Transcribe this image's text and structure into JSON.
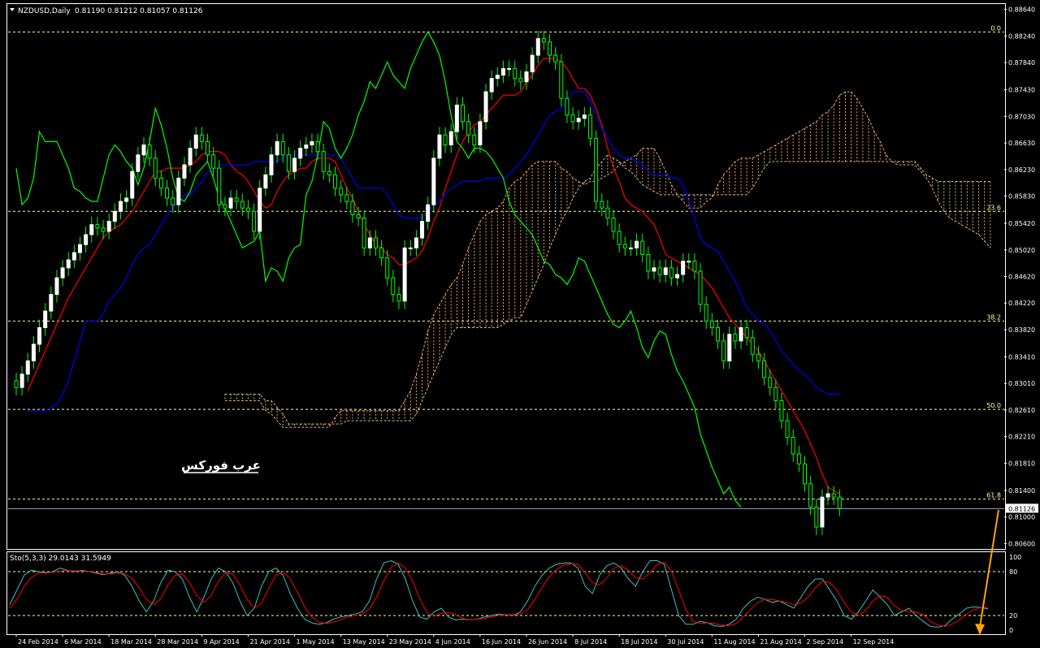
{
  "window": {
    "symbol": "NZDUSD,Daily",
    "ohlc": "0.81190 0.81212 0.81057 0.81126",
    "watermark": "عرب فوركس",
    "indicator_label": "Sto(5,3,3) 29.0143 31.5949"
  },
  "colors": {
    "background": "#000000",
    "candle": "#ffffff",
    "candle_wick": "#00ff00",
    "tenkan": "#ff0000",
    "kijun": "#0000ff",
    "chikou": "#00ff00",
    "cloud_up": "#f4a460",
    "cloud_down": "#d2b48c",
    "fib": "#ffff99",
    "stoch_main": "#40c0c0",
    "stoch_signal": "#ff0000",
    "arrow": "#ffa500",
    "axis": "#ffffff",
    "price_line": "#8fa9c7"
  },
  "chart_data": [
    {
      "type": "candlestick",
      "symbol": "NZDUSD",
      "timeframe": "Daily",
      "price_axis_ticks": [
        "0.88640",
        "0.88240",
        "0.87840",
        "0.87430",
        "0.87030",
        "0.86630",
        "0.86230",
        "0.85830",
        "0.85420",
        "0.85020",
        "0.84620",
        "0.84220",
        "0.83820",
        "0.83410",
        "0.83010",
        "0.82610",
        "0.82210",
        "0.81810",
        "0.81400",
        "0.81000",
        "0.80600"
      ],
      "ylim": [
        0.8052,
        0.8872
      ],
      "date_axis_ticks": [
        "24 Feb 2014",
        "6 Mar 2014",
        "18 Mar 2014",
        "28 Mar 2014",
        "9 Apr 2014",
        "21 Apr 2014",
        "1 May 2014",
        "13 May 2014",
        "23 May 2014",
        "4 Jun 2014",
        "16 Jun 2014",
        "26 Jun 2014",
        "8 Jul 2014",
        "18 Jul 2014",
        "30 Jul 2014",
        "11 Aug 2014",
        "21 Aug 2014",
        "2 Sep 2014",
        "12 Sep 2014"
      ],
      "current_price": "0.81126",
      "fibonacci": [
        {
          "label": "0.0",
          "value": 0.883
        },
        {
          "label": "23.6",
          "value": 0.856
        },
        {
          "label": "38.2",
          "value": 0.8395
        },
        {
          "label": "50.0",
          "value": 0.8262
        },
        {
          "label": "61.8",
          "value": 0.8127
        }
      ],
      "closes": [
        0.8295,
        0.8315,
        0.8335,
        0.836,
        0.8385,
        0.841,
        0.8435,
        0.846,
        0.8475,
        0.8487,
        0.8498,
        0.851,
        0.8525,
        0.854,
        0.8535,
        0.853,
        0.8545,
        0.856,
        0.8575,
        0.858,
        0.862,
        0.8645,
        0.866,
        0.864,
        0.861,
        0.8595,
        0.858,
        0.857,
        0.861,
        0.863,
        0.8655,
        0.8675,
        0.8665,
        0.8645,
        0.8625,
        0.857,
        0.8565,
        0.858,
        0.8575,
        0.8565,
        0.856,
        0.853,
        0.8595,
        0.8615,
        0.8645,
        0.8665,
        0.8645,
        0.862,
        0.864,
        0.8655,
        0.866,
        0.8665,
        0.865,
        0.862,
        0.8615,
        0.8595,
        0.8585,
        0.8575,
        0.8555,
        0.855,
        0.8505,
        0.852,
        0.8505,
        0.849,
        0.846,
        0.8435,
        0.8425,
        0.8505,
        0.8505,
        0.852,
        0.8545,
        0.857,
        0.864,
        0.8675,
        0.866,
        0.868,
        0.872,
        0.8695,
        0.8675,
        0.866,
        0.8695,
        0.874,
        0.876,
        0.8765,
        0.8775,
        0.8775,
        0.876,
        0.8755,
        0.877,
        0.8795,
        0.882,
        0.8815,
        0.8795,
        0.8785,
        0.873,
        0.8705,
        0.8695,
        0.87,
        0.8705,
        0.867,
        0.8575,
        0.8565,
        0.855,
        0.853,
        0.851,
        0.8505,
        0.8505,
        0.8515,
        0.8495,
        0.847,
        0.8475,
        0.8465,
        0.8475,
        0.846,
        0.8465,
        0.8485,
        0.8485,
        0.847,
        0.842,
        0.8395,
        0.8385,
        0.8365,
        0.8335,
        0.8375,
        0.8365,
        0.8385,
        0.837,
        0.8345,
        0.8335,
        0.831,
        0.8295,
        0.8275,
        0.8245,
        0.822,
        0.8195,
        0.818,
        0.815,
        0.8115,
        0.8085,
        0.813,
        0.8135,
        0.813,
        0.8113
      ],
      "tenkan_sen": [
        0.829,
        0.831,
        0.833,
        0.835,
        0.837,
        0.839,
        0.841,
        0.843,
        0.8445,
        0.846,
        0.8475,
        0.849,
        0.8505,
        0.852,
        0.853,
        0.8535,
        0.854,
        0.855,
        0.856,
        0.8575,
        0.859,
        0.8605,
        0.862,
        0.862,
        0.8625,
        0.8625,
        0.8625,
        0.8625,
        0.863,
        0.8635,
        0.8645,
        0.865,
        0.865,
        0.865,
        0.8645,
        0.863,
        0.862,
        0.8615,
        0.8605,
        0.859,
        0.8575,
        0.8565,
        0.857,
        0.859,
        0.8605,
        0.8615,
        0.862,
        0.8625,
        0.8625,
        0.8635,
        0.864,
        0.864,
        0.864,
        0.8635,
        0.8615,
        0.8595,
        0.858,
        0.856,
        0.854,
        0.8525,
        0.851,
        0.8505,
        0.8495,
        0.849,
        0.848,
        0.848,
        0.8485,
        0.849,
        0.85,
        0.852,
        0.8545,
        0.8565,
        0.8595,
        0.862,
        0.8645,
        0.8665,
        0.868,
        0.869,
        0.8695,
        0.8705,
        0.8715,
        0.8725,
        0.8735,
        0.8735,
        0.8735,
        0.874,
        0.8755,
        0.8765,
        0.878,
        0.879,
        0.879,
        0.879,
        0.8785,
        0.8775,
        0.876,
        0.8745,
        0.8745,
        0.8735,
        0.8715,
        0.869,
        0.8655,
        0.8625,
        0.8605,
        0.858,
        0.857,
        0.8565,
        0.856,
        0.855,
        0.854,
        0.852,
        0.8495,
        0.849,
        0.8485,
        0.848,
        0.8475,
        0.847,
        0.8465,
        0.8455,
        0.8445,
        0.843,
        0.8415,
        0.84,
        0.839,
        0.838,
        0.837,
        0.836,
        0.835,
        0.8335,
        0.832,
        0.8305,
        0.829,
        0.8275,
        0.826,
        0.8245,
        0.823,
        0.821,
        0.819,
        0.8165,
        0.8145,
        0.814,
        0.8135
      ],
      "kijun_sen": [
        0.826,
        0.826,
        0.826,
        0.826,
        0.8265,
        0.827,
        0.8285,
        0.8305,
        0.8335,
        0.8365,
        0.8395,
        0.8395,
        0.8395,
        0.8405,
        0.8425,
        0.8435,
        0.8445,
        0.846,
        0.848,
        0.8495,
        0.8505,
        0.851,
        0.8525,
        0.854,
        0.8555,
        0.8565,
        0.8575,
        0.8585,
        0.8585,
        0.8595,
        0.8605,
        0.862,
        0.862,
        0.863,
        0.863,
        0.863,
        0.863,
        0.863,
        0.863,
        0.8635,
        0.8635,
        0.8635,
        0.8635,
        0.8635,
        0.864,
        0.8645,
        0.8645,
        0.8645,
        0.8645,
        0.8645,
        0.8645,
        0.8645,
        0.8645,
        0.8645,
        0.864,
        0.8625,
        0.861,
        0.8595,
        0.8595,
        0.8595,
        0.8595,
        0.8595,
        0.8585,
        0.857,
        0.8555,
        0.855,
        0.855,
        0.855,
        0.855,
        0.856,
        0.857,
        0.8575,
        0.8585,
        0.8595,
        0.86,
        0.8605,
        0.8605,
        0.8605,
        0.8605,
        0.861,
        0.861,
        0.861,
        0.861,
        0.8615,
        0.8625,
        0.8635,
        0.8645,
        0.866,
        0.8675,
        0.869,
        0.8705,
        0.871,
        0.8715,
        0.873,
        0.874,
        0.874,
        0.874,
        0.8725,
        0.8705,
        0.8685,
        0.867,
        0.8655,
        0.8645,
        0.864,
        0.864,
        0.8635,
        0.863,
        0.862,
        0.8615,
        0.8615,
        0.8615,
        0.861,
        0.861,
        0.86,
        0.8575,
        0.855,
        0.852,
        0.851,
        0.8505,
        0.85,
        0.8485,
        0.847,
        0.8455,
        0.8435,
        0.8415,
        0.8405,
        0.8395,
        0.839,
        0.838,
        0.8365,
        0.835,
        0.834,
        0.833,
        0.832,
        0.8315,
        0.8305,
        0.8295,
        0.829,
        0.8285,
        0.8285,
        0.8285
      ],
      "chikou_span": [
        0.8625,
        0.857,
        0.858,
        0.861,
        0.868,
        0.8665,
        0.8665,
        0.8665,
        0.8645,
        0.8625,
        0.8595,
        0.859,
        0.858,
        0.8575,
        0.8575,
        0.861,
        0.8645,
        0.866,
        0.865,
        0.8635,
        0.8625,
        0.86,
        0.8625,
        0.8665,
        0.8715,
        0.869,
        0.8655,
        0.861,
        0.858,
        0.8575,
        0.859,
        0.8615,
        0.8625,
        0.8635,
        0.861,
        0.858,
        0.8565,
        0.8545,
        0.8525,
        0.8505,
        0.851,
        0.8515,
        0.853,
        0.8455,
        0.8475,
        0.847,
        0.8455,
        0.849,
        0.8505,
        0.851,
        0.8585,
        0.8605,
        0.8645,
        0.8695,
        0.8685,
        0.8655,
        0.864,
        0.8655,
        0.8675,
        0.8705,
        0.8725,
        0.8755,
        0.8745,
        0.8765,
        0.8785,
        0.8765,
        0.8755,
        0.8745,
        0.8775,
        0.8795,
        0.8815,
        0.883,
        0.8815,
        0.8795,
        0.8755,
        0.8705,
        0.8665,
        0.8655,
        0.864,
        0.8655,
        0.8655,
        0.865,
        0.864,
        0.8625,
        0.861,
        0.8575,
        0.8555,
        0.8545,
        0.8535,
        0.8525,
        0.8505,
        0.8485,
        0.848,
        0.8465,
        0.846,
        0.845,
        0.8465,
        0.849,
        0.8485,
        0.8465,
        0.8445,
        0.8425,
        0.8405,
        0.839,
        0.8385,
        0.8395,
        0.841,
        0.8385,
        0.8355,
        0.834,
        0.8365,
        0.838,
        0.8375,
        0.8345,
        0.832,
        0.8305,
        0.8285,
        0.8265,
        0.8225,
        0.82,
        0.8175,
        0.8155,
        0.8135,
        0.8145,
        0.8125,
        0.8115
      ],
      "senkou_a": [
        0.8275,
        0.8275,
        0.8275,
        0.8275,
        0.8275,
        0.8275,
        0.8275,
        0.826,
        0.8255,
        0.8245,
        0.8235,
        0.8235,
        0.8235,
        0.8235,
        0.8235,
        0.8235,
        0.8235,
        0.8235,
        0.8235,
        0.825,
        0.826,
        0.826,
        0.826,
        0.826,
        0.826,
        0.826,
        0.826,
        0.826,
        0.826,
        0.826,
        0.826,
        0.8275,
        0.829,
        0.8315,
        0.8345,
        0.838,
        0.8405,
        0.842,
        0.8435,
        0.845,
        0.846,
        0.848,
        0.8505,
        0.8525,
        0.8545,
        0.8555,
        0.856,
        0.8565,
        0.8575,
        0.8595,
        0.8605,
        0.861,
        0.862,
        0.863,
        0.8635,
        0.8635,
        0.8635,
        0.8635,
        0.8625,
        0.862,
        0.861,
        0.8605,
        0.86,
        0.8605,
        0.8605,
        0.861,
        0.8615,
        0.862,
        0.863,
        0.8635,
        0.864,
        0.8645,
        0.8655,
        0.8655,
        0.8655,
        0.864,
        0.862,
        0.86,
        0.8585,
        0.8575,
        0.8565,
        0.8565,
        0.8565,
        0.8575,
        0.858,
        0.86,
        0.8615,
        0.8625,
        0.8635,
        0.864,
        0.864,
        0.864,
        0.8645,
        0.865,
        0.8655,
        0.866,
        0.8665,
        0.867,
        0.8675,
        0.868,
        0.8685,
        0.869,
        0.8695,
        0.8705,
        0.871,
        0.872,
        0.8735,
        0.874,
        0.874,
        0.873,
        0.8715,
        0.87,
        0.868,
        0.8665,
        0.8645,
        0.8635,
        0.863,
        0.863,
        0.863,
        0.863,
        0.862,
        0.861,
        0.8595,
        0.8575,
        0.856,
        0.855,
        0.8545,
        0.854,
        0.8535,
        0.853,
        0.8525,
        0.8515,
        0.8505
      ],
      "senkou_b": [
        0.8285,
        0.8285,
        0.8285,
        0.8285,
        0.8285,
        0.8285,
        0.8285,
        0.8275,
        0.8275,
        0.8265,
        0.8255,
        0.824,
        0.824,
        0.824,
        0.824,
        0.824,
        0.824,
        0.824,
        0.824,
        0.824,
        0.824,
        0.8245,
        0.8245,
        0.8245,
        0.8245,
        0.8245,
        0.8245,
        0.8245,
        0.8245,
        0.8245,
        0.8245,
        0.8245,
        0.8245,
        0.8255,
        0.8275,
        0.8295,
        0.8315,
        0.8335,
        0.8355,
        0.8375,
        0.8385,
        0.8385,
        0.8385,
        0.8385,
        0.8385,
        0.8385,
        0.8385,
        0.8385,
        0.839,
        0.8395,
        0.84,
        0.84,
        0.842,
        0.844,
        0.846,
        0.848,
        0.8505,
        0.8525,
        0.8545,
        0.856,
        0.858,
        0.8595,
        0.8605,
        0.861,
        0.8625,
        0.8635,
        0.8645,
        0.864,
        0.8635,
        0.8625,
        0.862,
        0.861,
        0.86,
        0.8595,
        0.859,
        0.8585,
        0.8585,
        0.8585,
        0.8585,
        0.8585,
        0.8585,
        0.8585,
        0.8585,
        0.8585,
        0.8585,
        0.8585,
        0.8585,
        0.8585,
        0.8585,
        0.8585,
        0.8585,
        0.8595,
        0.861,
        0.8625,
        0.8635,
        0.8635,
        0.8635,
        0.8635,
        0.8635,
        0.8635,
        0.8635,
        0.8635,
        0.8635,
        0.8635,
        0.8635,
        0.8635,
        0.8635,
        0.8635,
        0.8635,
        0.8635,
        0.8635,
        0.8635,
        0.8635,
        0.8635,
        0.8635,
        0.8635,
        0.8635,
        0.8635,
        0.8635,
        0.8635,
        0.8625,
        0.8615,
        0.861,
        0.8605,
        0.8605,
        0.8605,
        0.8605,
        0.8605,
        0.8605,
        0.8605,
        0.8605,
        0.8605,
        0.8605
      ]
    },
    {
      "type": "line",
      "name": "Sto(5,3,3)",
      "ylim": [
        0,
        100
      ],
      "levels": [
        20,
        80
      ],
      "y_ticks": [
        "100",
        "80",
        "20",
        "0"
      ],
      "main": [
        35,
        55,
        75,
        82,
        80,
        78,
        80,
        85,
        82,
        80,
        82,
        80,
        78,
        76,
        78,
        80,
        75,
        60,
        40,
        25,
        40,
        65,
        82,
        80,
        70,
        45,
        25,
        45,
        70,
        85,
        80,
        65,
        40,
        20,
        30,
        60,
        80,
        85,
        75,
        50,
        30,
        15,
        10,
        8,
        10,
        15,
        18,
        20,
        22,
        25,
        40,
        70,
        92,
        95,
        90,
        70,
        40,
        18,
        15,
        25,
        30,
        18,
        14,
        15,
        14,
        15,
        18,
        20,
        22,
        21,
        20,
        25,
        40,
        60,
        75,
        85,
        90,
        92,
        92,
        85,
        60,
        50,
        75,
        88,
        92,
        85,
        70,
        60,
        80,
        95,
        95,
        90,
        55,
        20,
        8,
        8,
        12,
        10,
        6,
        5,
        8,
        15,
        30,
        40,
        45,
        42,
        38,
        40,
        35,
        30,
        45,
        60,
        70,
        70,
        55,
        40,
        20,
        15,
        25,
        40,
        55,
        45,
        35,
        20,
        25,
        30,
        20,
        12,
        5,
        4,
        6,
        15,
        22,
        30,
        32,
        31,
        29
      ],
      "signal": [
        30,
        42,
        60,
        72,
        78,
        79,
        79,
        81,
        82,
        81,
        81,
        80,
        79,
        77,
        77,
        78,
        77,
        71,
        58,
        42,
        35,
        43,
        62,
        75,
        77,
        65,
        47,
        38,
        47,
        67,
        78,
        77,
        62,
        42,
        30,
        37,
        57,
        75,
        80,
        70,
        52,
        32,
        18,
        11,
        9,
        11,
        14,
        18,
        20,
        22,
        29,
        45,
        67,
        86,
        92,
        85,
        67,
        43,
        24,
        19,
        23,
        24,
        21,
        16,
        14,
        15,
        16,
        18,
        20,
        21,
        21,
        22,
        28,
        42,
        58,
        73,
        83,
        89,
        91,
        90,
        79,
        65,
        62,
        71,
        85,
        88,
        82,
        72,
        70,
        78,
        90,
        93,
        80,
        55,
        28,
        12,
        9,
        10,
        9,
        7,
        6,
        9,
        18,
        28,
        38,
        42,
        42,
        40,
        38,
        35,
        37,
        45,
        58,
        67,
        65,
        55,
        38,
        25,
        20,
        27,
        40,
        47,
        45,
        33,
        27,
        25,
        25,
        21,
        12,
        7,
        5,
        8,
        14,
        22,
        28,
        31,
        31
      ]
    }
  ]
}
